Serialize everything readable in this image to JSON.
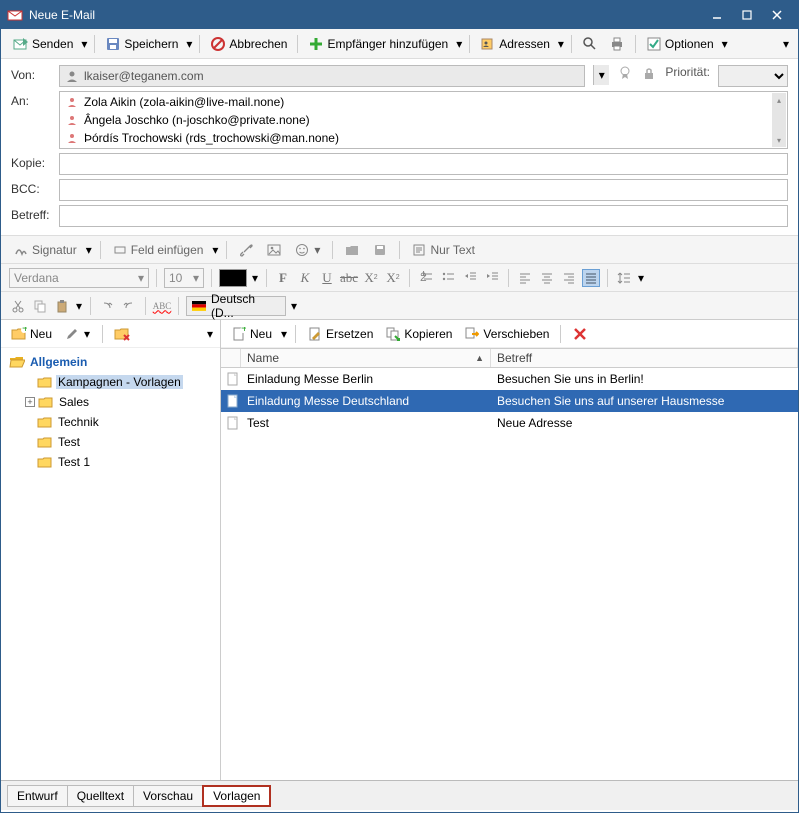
{
  "window": {
    "title": "Neue E-Mail"
  },
  "toolbar": {
    "send": "Senden",
    "save": "Speichern",
    "cancel": "Abbrechen",
    "addRecipient": "Empfänger hinzufügen",
    "addresses": "Adressen",
    "options": "Optionen"
  },
  "fields": {
    "fromLabel": "Von:",
    "fromValue": "lkaiser@teganem.com",
    "toLabel": "An:",
    "toRecipients": [
      "Zola Aikin (zola-aikin@live-mail.none)",
      "Ângela Joschko (n-joschko@private.none)",
      "Þórdís Trochowski (rds_trochowski@man.none)"
    ],
    "ccLabel": "Kopie:",
    "bccLabel": "BCC:",
    "subjectLabel": "Betreff:",
    "priorityLabel": "Priorität:"
  },
  "editorTb1": {
    "signature": "Signatur",
    "insertField": "Feld einfügen",
    "plainText": "Nur Text"
  },
  "editorTb2": {
    "font": "Verdana",
    "size": "10",
    "lang": "Deutsch (D..."
  },
  "sidebar": {
    "newLabel": "Neu",
    "tree": {
      "root": "Allgemein",
      "items": [
        "Kampagnen - Vorlagen",
        "Sales",
        "Technik",
        "Test",
        "Test 1"
      ]
    }
  },
  "tmplToolbar": {
    "neu": "Neu",
    "ersetzen": "Ersetzen",
    "kopieren": "Kopieren",
    "verschieben": "Verschieben"
  },
  "table": {
    "colName": "Name",
    "colBetreff": "Betreff",
    "rows": [
      {
        "name": "Einladung Messe Berlin",
        "betreff": "Besuchen Sie uns in Berlin!"
      },
      {
        "name": "Einladung Messe Deutschland",
        "betreff": "Besuchen Sie uns auf unserer Hausmesse"
      },
      {
        "name": "Test",
        "betreff": "Neue Adresse"
      }
    ],
    "selectedIndex": 1
  },
  "tabs": {
    "draft": "Entwurf",
    "source": "Quelltext",
    "preview": "Vorschau",
    "templates": "Vorlagen"
  }
}
